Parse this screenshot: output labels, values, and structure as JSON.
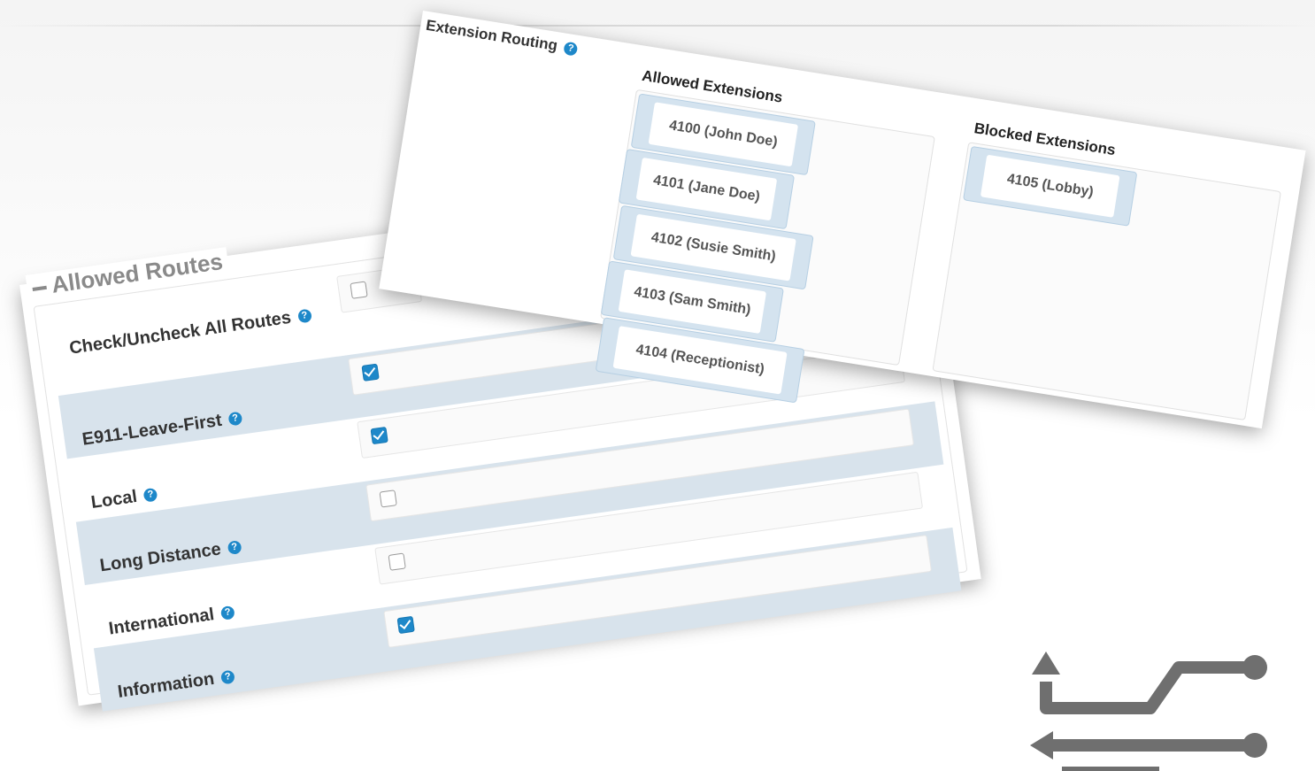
{
  "allowed_routes": {
    "title": "Allowed Routes",
    "check_all": {
      "label": "Check/Uncheck All Routes",
      "checked": false
    },
    "routes": [
      {
        "label": "E911-Leave-First",
        "checked": true
      },
      {
        "label": "Local",
        "checked": true
      },
      {
        "label": "Long Distance",
        "checked": false
      },
      {
        "label": "International",
        "checked": false
      },
      {
        "label": "Information",
        "checked": true
      }
    ]
  },
  "extension_routing": {
    "title": "Extension Routing",
    "allowed_title": "Allowed Extensions",
    "blocked_title": "Blocked Extensions",
    "allowed": [
      "4100 (John Doe)",
      "4101 (Jane Doe)",
      "4102 (Susie Smith)",
      "4103 (Sam Smith)",
      "4104 (Receptionist)"
    ],
    "blocked": [
      "4105 (Lobby)"
    ]
  },
  "icons": {
    "help": "question-circle-icon",
    "routing": "routing-arrows-icon"
  },
  "colors": {
    "accent": "#1e88c9",
    "row_shade": "#d8e3ec",
    "item_bg": "#d4e3ef"
  }
}
